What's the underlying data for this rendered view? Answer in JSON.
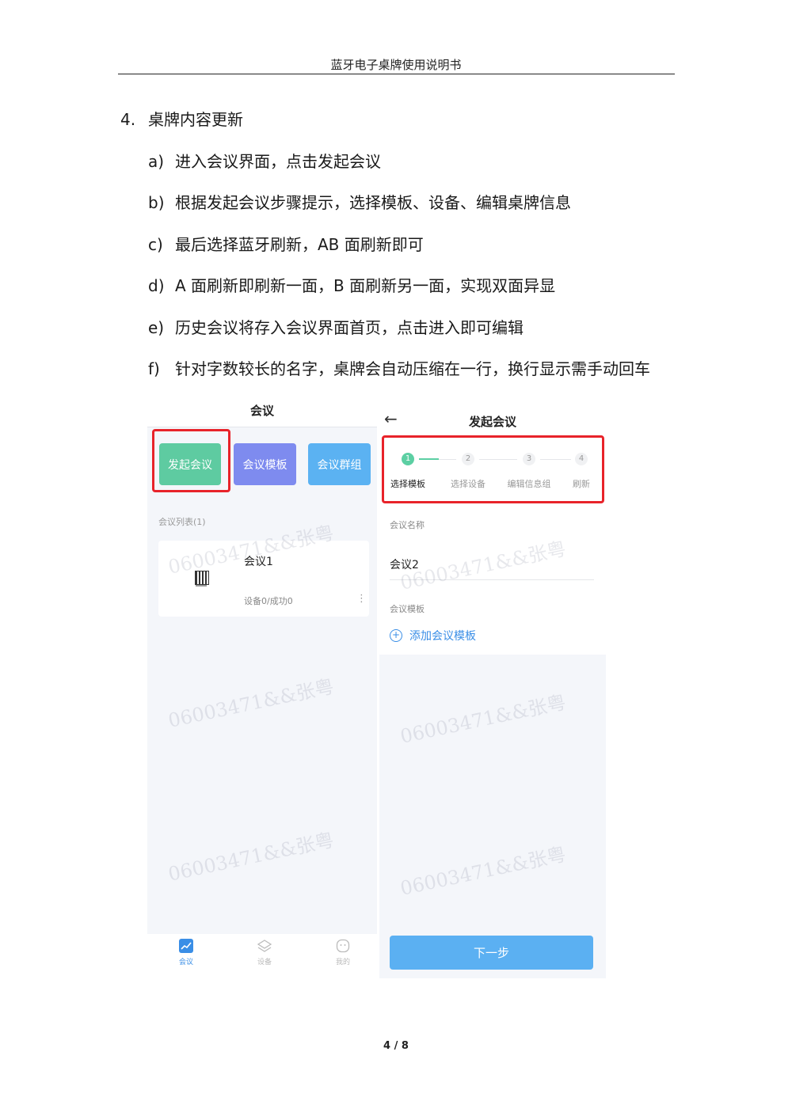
{
  "header": {
    "title": "蓝牙电子桌牌使用说明书"
  },
  "section": {
    "number": "4.",
    "title": "桌牌内容更新",
    "items": [
      {
        "marker": "a)",
        "text": "进入会议界面，点击发起会议"
      },
      {
        "marker": "b)",
        "text": "根据发起会议步骤提示，选择模板、设备、编辑桌牌信息"
      },
      {
        "marker": "c)",
        "text": "最后选择蓝牙刷新，AB 面刷新即可"
      },
      {
        "marker": "d)",
        "text": "A 面刷新即刷新一面，B 面刷新另一面，实现双面异显"
      },
      {
        "marker": "e)",
        "text": "历史会议将存入会议界面首页，点击进入即可编辑"
      },
      {
        "marker": "f)",
        "text": "针对字数较长的名字，桌牌会自动压缩在一行，换行显示需手动回车"
      }
    ]
  },
  "screen_left": {
    "title": "会议",
    "buttons": [
      {
        "label": "发起会议",
        "color": "#5ecba1"
      },
      {
        "label": "会议模板",
        "color": "#7e8bef"
      },
      {
        "label": "会议群组",
        "color": "#5bb2f2"
      }
    ],
    "list_label": "会议列表(1)",
    "card": {
      "name": "会议1",
      "status": "设备0/成功0"
    },
    "watermark": "06003471&&张粤",
    "tabs": [
      {
        "label": "会议",
        "icon": "chart-icon"
      },
      {
        "label": "设备",
        "icon": "layers-icon"
      },
      {
        "label": "我的",
        "icon": "face-icon"
      }
    ]
  },
  "screen_right": {
    "title": "发起会议",
    "steps": [
      {
        "num": "1",
        "label": "选择模板"
      },
      {
        "num": "2",
        "label": "选择设备"
      },
      {
        "num": "3",
        "label": "编辑信息组"
      },
      {
        "num": "4",
        "label": "刷新"
      }
    ],
    "name_label": "会议名称",
    "name_value": "会议2",
    "template_label": "会议模板",
    "add_template": "添加会议模板",
    "next_button": "下一步",
    "watermark": "06003471&&张粤"
  },
  "colors": {
    "highlight": "#e8232a",
    "accent": "#5ccfa3",
    "link": "#3a8ee6"
  },
  "footer": {
    "page": "4 / 8"
  }
}
